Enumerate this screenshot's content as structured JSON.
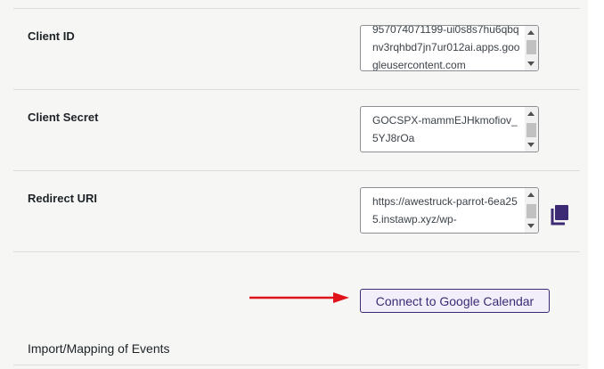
{
  "settings": {
    "client_id": {
      "label": "Client ID",
      "value": "957074071199-ui0s8s7hu6qbqnv3rqhbd7jn7ur012ai.apps.googleusercontent.com"
    },
    "client_secret": {
      "label": "Client Secret",
      "value": "GOCSPX-mammEJHkmofiov_5YJ8rOa"
    },
    "redirect_uri": {
      "label": "Redirect URI",
      "value": "https://awestruck-parrot-6ea255.instawp.xyz/wp-"
    },
    "connect_button": {
      "label": "Connect to Google Calendar"
    },
    "import_section": {
      "title": "Import/Mapping of Events"
    }
  },
  "icons": {
    "copy": "copy-icon",
    "arrow": "red-arrow-icon"
  },
  "colors": {
    "accent": "#3c2b74",
    "arrow": "#e0131b",
    "panel_bg": "#f6f6f4"
  }
}
